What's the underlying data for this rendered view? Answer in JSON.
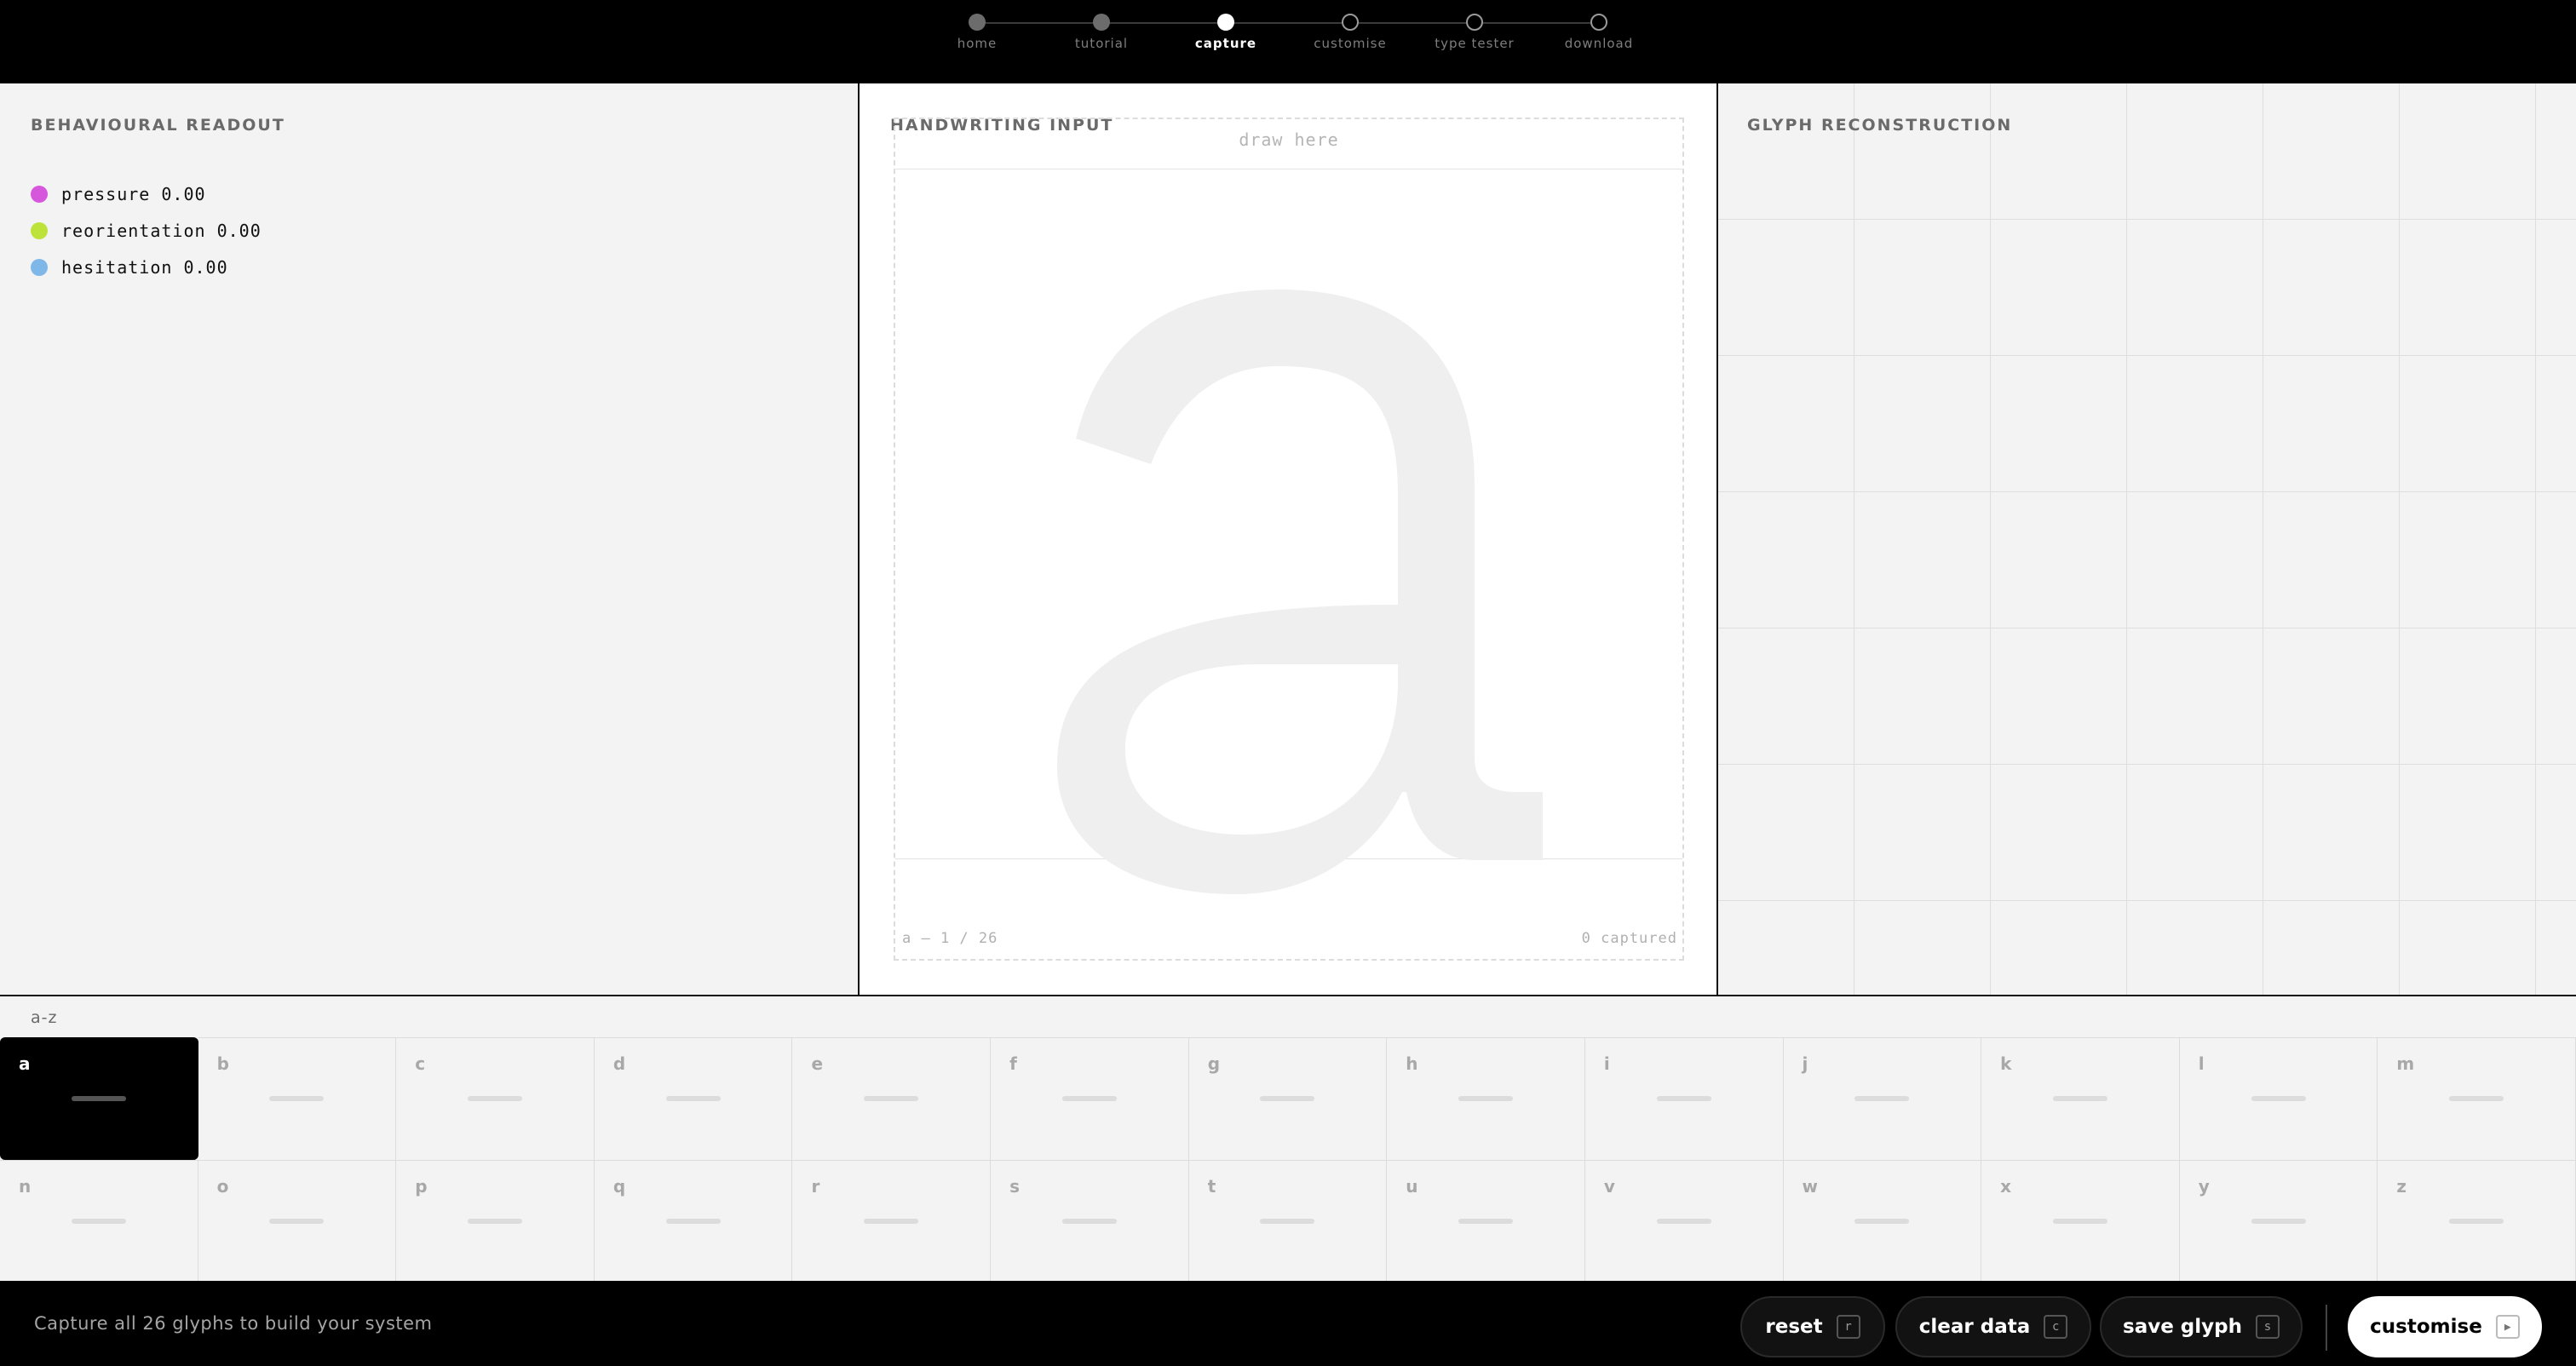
{
  "steps": [
    {
      "label": "home",
      "state": "done"
    },
    {
      "label": "tutorial",
      "state": "done"
    },
    {
      "label": "capture",
      "state": "current"
    },
    {
      "label": "customise",
      "state": "todo"
    },
    {
      "label": "type tester",
      "state": "todo"
    },
    {
      "label": "download",
      "state": "todo"
    }
  ],
  "left_panel": {
    "title": "BEHAVIOURAL READOUT",
    "metrics": [
      {
        "label": "pressure 0.00",
        "color": "#d757dc"
      },
      {
        "label": "reorientation 0.00",
        "color": "#bde33a"
      },
      {
        "label": "hesitation 0.00",
        "color": "#7fb8e8"
      }
    ]
  },
  "center_panel": {
    "title": "HANDWRITING INPUT",
    "hint": "draw here",
    "guide_letter": "a",
    "progress": "a — 1 / 26",
    "captured": "0 captured"
  },
  "right_panel": {
    "title": "GLYPH RECONSTRUCTION"
  },
  "grid": {
    "label": "a-z",
    "active": "a",
    "letters": [
      "a",
      "b",
      "c",
      "d",
      "e",
      "f",
      "g",
      "h",
      "i",
      "j",
      "k",
      "l",
      "m",
      "n",
      "o",
      "p",
      "q",
      "r",
      "s",
      "t",
      "u",
      "v",
      "w",
      "x",
      "y",
      "z"
    ]
  },
  "bottom": {
    "status": "Capture all 26 glyphs to build your system",
    "reset": {
      "label": "reset",
      "key": "r"
    },
    "clear": {
      "label": "clear data",
      "key": "c"
    },
    "save": {
      "label": "save glyph",
      "key": "s"
    },
    "next": {
      "label": "customise",
      "key": "▶"
    }
  },
  "colors": {
    "background": "#f3f3f3",
    "bar": "#000000",
    "guide_letter": "#efefef"
  }
}
